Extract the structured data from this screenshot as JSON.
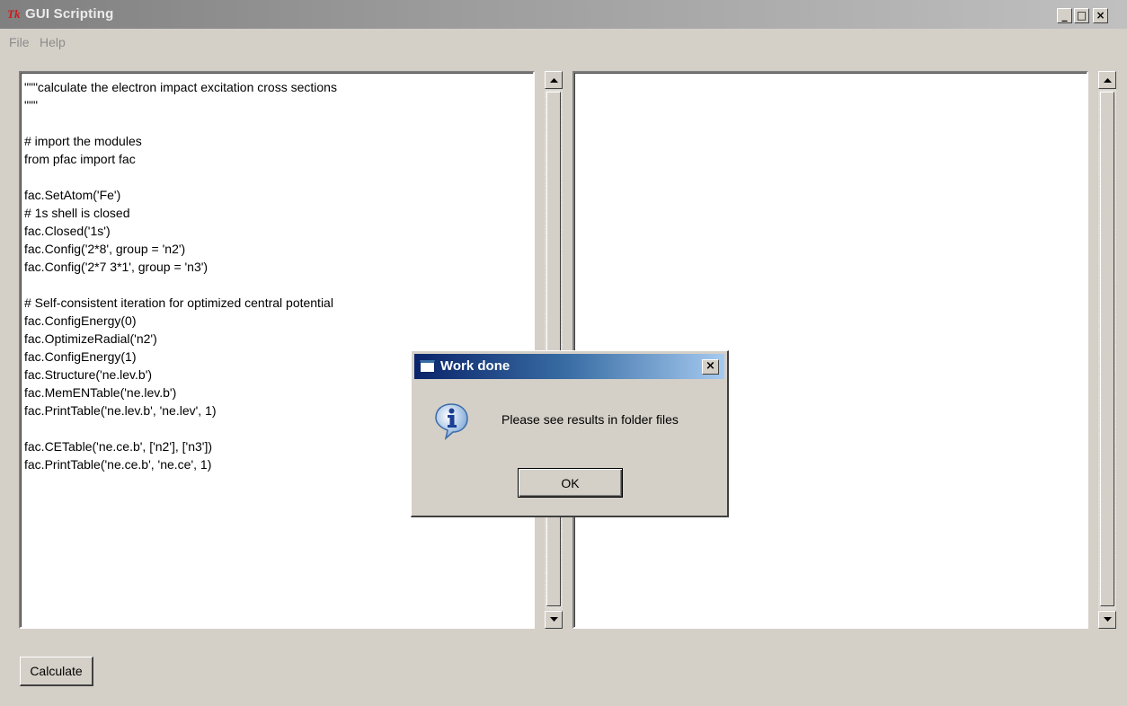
{
  "window": {
    "title": "GUI Scripting",
    "logo_text": "Tk",
    "controls": {
      "minimize": "_",
      "maximize": "□",
      "close": "×"
    }
  },
  "menu": {
    "items": [
      "File",
      "Help"
    ]
  },
  "editor": {
    "lines": [
      "\"\"\"calculate the electron impact excitation cross sections",
      "\"\"\"",
      "",
      "# import the modules",
      "from pfac import fac",
      "",
      "fac.SetAtom('Fe')",
      "# 1s shell is closed",
      "fac.Closed('1s')",
      "fac.Config('2*8', group = 'n2')",
      "fac.Config('2*7 3*1', group = 'n3')",
      "",
      "# Self-consistent iteration for optimized central potential",
      "fac.ConfigEnergy(0)",
      "fac.OptimizeRadial('n2')",
      "fac.ConfigEnergy(1)",
      "fac.Structure('ne.lev.b')",
      "fac.MemENTable('ne.lev.b')",
      "fac.PrintTable('ne.lev.b', 'ne.lev', 1)",
      "",
      "fac.CETable('ne.ce.b', ['n2'], ['n3'])",
      "fac.PrintTable('ne.ce.b', 'ne.ce', 1)"
    ]
  },
  "output": {
    "text": ""
  },
  "actions": {
    "calculate_label": "Calculate"
  },
  "dialog": {
    "title": "Work done",
    "close": "×",
    "message": "Please see results in folder files",
    "ok_label": "OK",
    "icon": "info-icon"
  },
  "colors": {
    "window_bg": "#d4d0c8",
    "dialog_title_start": "#0a246a",
    "dialog_title_end": "#a6caf0",
    "tk_logo": "#c81e1e"
  }
}
